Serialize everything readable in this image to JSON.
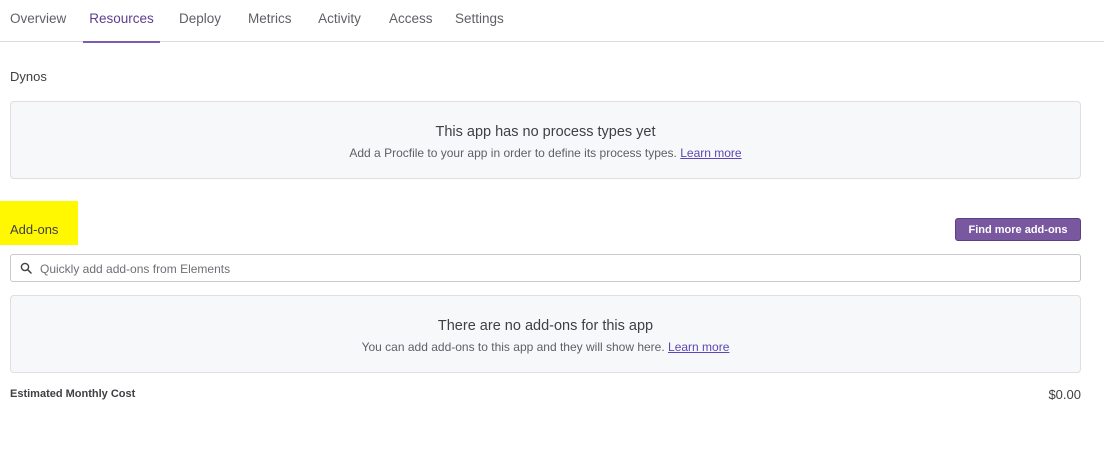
{
  "tabs": [
    {
      "label": "Overview",
      "active": false
    },
    {
      "label": "Resources",
      "active": true
    },
    {
      "label": "Deploy",
      "active": false
    },
    {
      "label": "Metrics",
      "active": false
    },
    {
      "label": "Activity",
      "active": false
    },
    {
      "label": "Access",
      "active": false
    },
    {
      "label": "Settings",
      "active": false
    }
  ],
  "dynos": {
    "title": "Dynos",
    "empty_title": "This app has no process types yet",
    "empty_text": "Add a Procfile to your app in order to define its process types.",
    "learn_more": "Learn more"
  },
  "addons": {
    "title": "Add-ons",
    "find_button": "Find more add-ons",
    "search_placeholder": "Quickly add add-ons from Elements",
    "search_value": "",
    "empty_title": "There are no add-ons for this app",
    "empty_text": "You can add add-ons to this app and they will show here.",
    "learn_more": "Learn more"
  },
  "cost": {
    "label": "Estimated Monthly Cost",
    "value": "$0.00"
  },
  "colors": {
    "accent": "#79589f",
    "highlight": "#fff800",
    "link": "#5f45b5"
  },
  "icons": {
    "search": "search-icon"
  }
}
